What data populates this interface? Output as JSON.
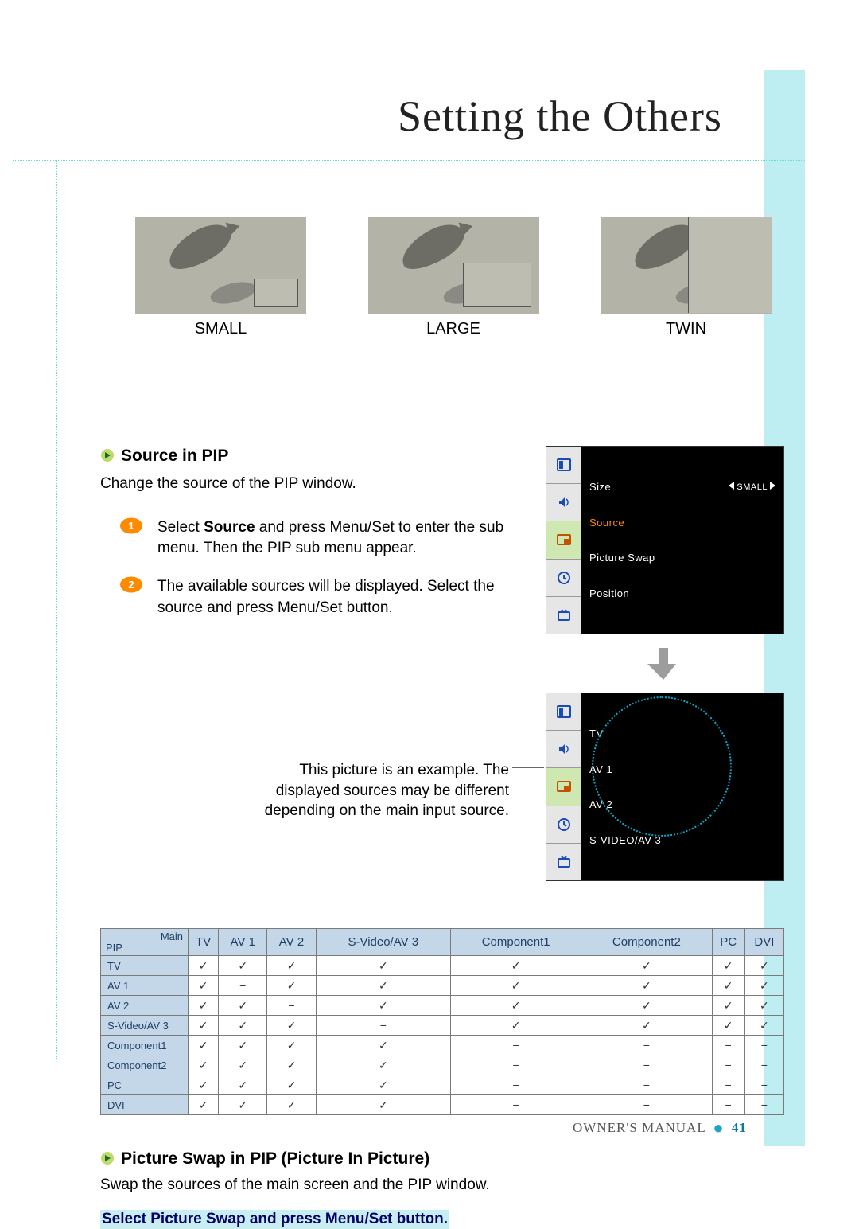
{
  "title": "Setting the Others",
  "size_row": {
    "small": "SMALL",
    "large": "LARGE",
    "twin": "TWIN"
  },
  "section_source": {
    "heading": "Source in PIP",
    "desc": "Change the source of the PIP window.",
    "step1_a": "Select ",
    "step1_b": "Source",
    "step1_c": " and press Menu/Set to enter the sub menu. Then the PIP sub menu appear.",
    "step2": "The available sources will be displayed. Select the source and press Menu/Set button."
  },
  "note": "This picture is an example. The displayed sources may be different depending on the main input source.",
  "osd_menu1": {
    "items": [
      {
        "label": "Size",
        "value": "SMALL",
        "arrows": true,
        "selected": false
      },
      {
        "label": "Source",
        "value": "",
        "arrows": false,
        "selected": true
      },
      {
        "label": "Picture Swap",
        "value": "",
        "arrows": false,
        "selected": false
      },
      {
        "label": "Position",
        "value": "",
        "arrows": false,
        "selected": false
      }
    ]
  },
  "osd_menu2": {
    "items": [
      {
        "label": "TV"
      },
      {
        "label": "AV 1"
      },
      {
        "label": "AV 2"
      },
      {
        "label": "S-VIDEO/AV 3"
      }
    ]
  },
  "matrix": {
    "corner_pip": "PIP",
    "corner_main": "Main",
    "cols": [
      "TV",
      "AV 1",
      "AV 2",
      "S-Video/AV 3",
      "Component1",
      "Component2",
      "PC",
      "DVI"
    ],
    "rows": [
      {
        "name": "TV",
        "cells": [
          "y",
          "y",
          "y",
          "y",
          "y",
          "y",
          "y",
          "y"
        ]
      },
      {
        "name": "AV 1",
        "cells": [
          "y",
          "n",
          "y",
          "y",
          "y",
          "y",
          "y",
          "y"
        ]
      },
      {
        "name": "AV 2",
        "cells": [
          "y",
          "y",
          "n",
          "y",
          "y",
          "y",
          "y",
          "y"
        ]
      },
      {
        "name": "S-Video/AV 3",
        "cells": [
          "y",
          "y",
          "y",
          "n",
          "y",
          "y",
          "y",
          "y"
        ]
      },
      {
        "name": "Component1",
        "cells": [
          "y",
          "y",
          "y",
          "y",
          "n",
          "n",
          "n",
          "n"
        ]
      },
      {
        "name": "Component2",
        "cells": [
          "y",
          "y",
          "y",
          "y",
          "n",
          "n",
          "n",
          "n"
        ]
      },
      {
        "name": "PC",
        "cells": [
          "y",
          "y",
          "y",
          "y",
          "n",
          "n",
          "n",
          "n"
        ]
      },
      {
        "name": "DVI",
        "cells": [
          "y",
          "y",
          "y",
          "y",
          "n",
          "n",
          "n",
          "n"
        ]
      }
    ]
  },
  "section_swap": {
    "heading": "Picture Swap in PIP (Picture In Picture)",
    "desc": "Swap the sources of the main screen and the PIP window.",
    "instruction": "Select Picture Swap and press Menu/Set button."
  },
  "footer": {
    "label": "OWNER'S MANUAL",
    "page": "41"
  }
}
